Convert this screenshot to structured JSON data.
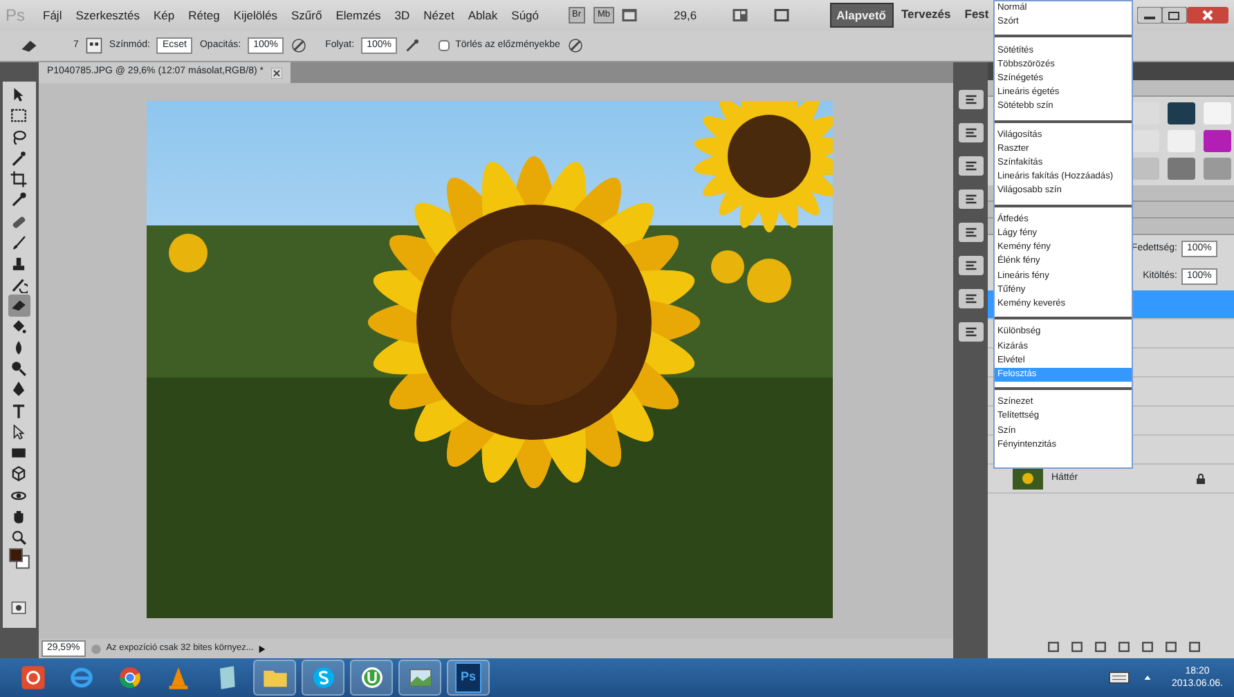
{
  "app_bar": {
    "logo": "Ps",
    "menus": [
      "Fájl",
      "Szerkesztés",
      "Kép",
      "Réteg",
      "Kijelölés",
      "Szűrő",
      "Elemzés",
      "3D",
      "Nézet",
      "Ablak",
      "Súgó"
    ],
    "bridge_button": "Br",
    "mini_bridge_button": "Mb",
    "zoom": "29,6",
    "workspaces": [
      {
        "label": "Alapvető",
        "selected": true
      },
      {
        "label": "Tervezés",
        "selected": false
      },
      {
        "label": "Fest",
        "selected": false
      }
    ]
  },
  "options_bar": {
    "brush_size": "7",
    "mode_label": "Színmód:",
    "mode_value": "Ecset",
    "opacity_label": "Opacitás:",
    "opacity_value": "100%",
    "flow_label": "Folyat:",
    "flow_value": "100%",
    "erase_to_history": {
      "label": "Törlés az előzményekbe",
      "checked": false
    }
  },
  "tools": [
    {
      "kind": "move",
      "selected": false
    },
    {
      "kind": "marquee",
      "selected": false
    },
    {
      "kind": "lasso",
      "selected": false
    },
    {
      "kind": "wand",
      "selected": false
    },
    {
      "kind": "crop",
      "selected": false
    },
    {
      "kind": "eyedropper",
      "selected": false
    },
    {
      "kind": "healing",
      "selected": false
    },
    {
      "kind": "brush",
      "selected": false
    },
    {
      "kind": "stamp",
      "selected": false
    },
    {
      "kind": "history",
      "selected": false
    },
    {
      "kind": "eraser",
      "selected": true
    },
    {
      "kind": "bucket",
      "selected": false
    },
    {
      "kind": "blur",
      "selected": false
    },
    {
      "kind": "dodge",
      "selected": false
    },
    {
      "kind": "pen",
      "selected": false
    },
    {
      "kind": "type",
      "selected": false
    },
    {
      "kind": "path",
      "selected": false
    },
    {
      "kind": "shape",
      "selected": false
    },
    {
      "kind": "rotate3d",
      "selected": false
    },
    {
      "kind": "orbit3d",
      "selected": false
    },
    {
      "kind": "hand",
      "selected": false
    },
    {
      "kind": "zoom",
      "selected": false
    }
  ],
  "document_tab": {
    "title": "P1040785.JPG @ 29,6% (12:07 másolat,RGB/8) *"
  },
  "status_bar": {
    "zoom": "29,59%",
    "info": "Az expozíció csak 32 bites környez..."
  },
  "layers_panel": {
    "opacity_label": "Fedettség:",
    "opacity_value": "100%",
    "fill_label": "Kitöltés:",
    "fill_value": "100%",
    "layers": [
      {
        "selected": true
      },
      {
        "selected": false
      },
      {
        "selected": false
      },
      {
        "selected": false
      },
      {
        "selected": false
      },
      {
        "selected": false
      },
      {
        "name": "Háttér",
        "selected": false
      }
    ]
  },
  "blend_mode_menu": {
    "groups": [
      {
        "items": [
          {
            "label": "Normál",
            "selected": false
          },
          {
            "label": "Szórt",
            "selected": false
          }
        ]
      },
      {
        "items": [
          {
            "label": "Sötétítés",
            "selected": false
          },
          {
            "label": "Többszörözés",
            "selected": false
          },
          {
            "label": "Színégetés",
            "selected": false
          },
          {
            "label": "Lineáris égetés",
            "selected": false
          },
          {
            "label": "Sötétebb szín",
            "selected": false
          }
        ]
      },
      {
        "items": [
          {
            "label": "Világosítás",
            "selected": false
          },
          {
            "label": "Raszter",
            "selected": false
          },
          {
            "label": "Színfakítás",
            "selected": false
          },
          {
            "label": "Lineáris fakítás (Hozzáadás)",
            "selected": false
          },
          {
            "label": "Világosabb szín",
            "selected": false
          }
        ]
      },
      {
        "items": [
          {
            "label": "Átfedés",
            "selected": false
          },
          {
            "label": "Lágy fény",
            "selected": false
          },
          {
            "label": "Kemény fény",
            "selected": false
          },
          {
            "label": "Élénk fény",
            "selected": false
          },
          {
            "label": "Lineáris fény",
            "selected": false
          },
          {
            "label": "Tűfény",
            "selected": false
          },
          {
            "label": "Kemény keverés",
            "selected": false
          }
        ]
      },
      {
        "items": [
          {
            "label": "Különbség",
            "selected": false
          },
          {
            "label": "Kizárás",
            "selected": false
          },
          {
            "label": "Elvétel",
            "selected": false
          },
          {
            "label": "Felosztás",
            "selected": true
          }
        ]
      },
      {
        "items": [
          {
            "label": "Színezet",
            "selected": false
          },
          {
            "label": "Telítettség",
            "selected": false
          },
          {
            "label": "Szín",
            "selected": false
          },
          {
            "label": "Fényintenzitás",
            "selected": false
          }
        ]
      }
    ]
  },
  "taskbar": {
    "apps": [
      {
        "kind": "power",
        "running": false
      },
      {
        "kind": "ie",
        "running": false
      },
      {
        "kind": "chrome",
        "running": false
      },
      {
        "kind": "vlc",
        "running": false
      },
      {
        "kind": "notepad",
        "running": false
      },
      {
        "kind": "folder",
        "running": true
      },
      {
        "kind": "skype",
        "running": true
      },
      {
        "kind": "torrent",
        "running": true
      },
      {
        "kind": "viewer",
        "running": true
      },
      {
        "kind": "photoshop",
        "label": "Ps",
        "running": true
      }
    ],
    "clock": {
      "time": "18:20",
      "date": "2013.06.06."
    }
  }
}
